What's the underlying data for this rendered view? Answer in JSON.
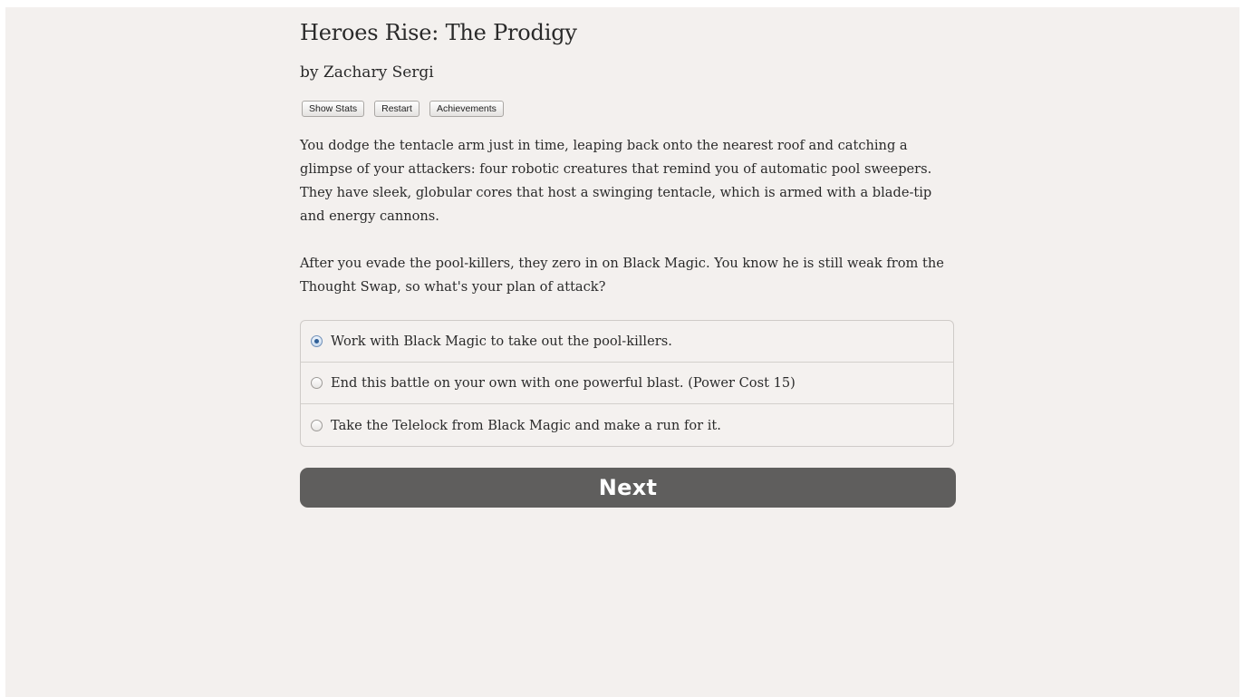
{
  "game": {
    "title": "Heroes Rise: The Prodigy",
    "author": "by Zachary Sergi"
  },
  "toolbar": {
    "show_stats_label": "Show Stats",
    "restart_label": "Restart",
    "achievements_label": "Achievements"
  },
  "passage": {
    "paragraphs": [
      "You dodge the tentacle arm just in time, leaping back onto the nearest roof and catching a glimpse of your attackers: four robotic creatures that remind you of automatic pool sweepers. They have sleek, globular cores that host a swinging tentacle, which is armed with a blade-tip and energy cannons.",
      "After you evade the pool-killers, they zero in on Black Magic. You know he is still weak from the Thought Swap, so what's your plan of attack?"
    ]
  },
  "choices": {
    "selected_index": 0,
    "options": [
      {
        "label": "Work with Black Magic to take out the pool-killers.",
        "selected": true
      },
      {
        "label": "End this battle on your own with one powerful blast. (Power Cost 15)",
        "selected": false
      },
      {
        "label": "Take the Telelock from Black Magic and make a run for it.",
        "selected": false
      }
    ]
  },
  "next_button": {
    "label": "Next",
    "background": "#5f5e5d"
  },
  "colors": {
    "page_background": "#f3f0ee",
    "text": "#2a2a2a"
  }
}
